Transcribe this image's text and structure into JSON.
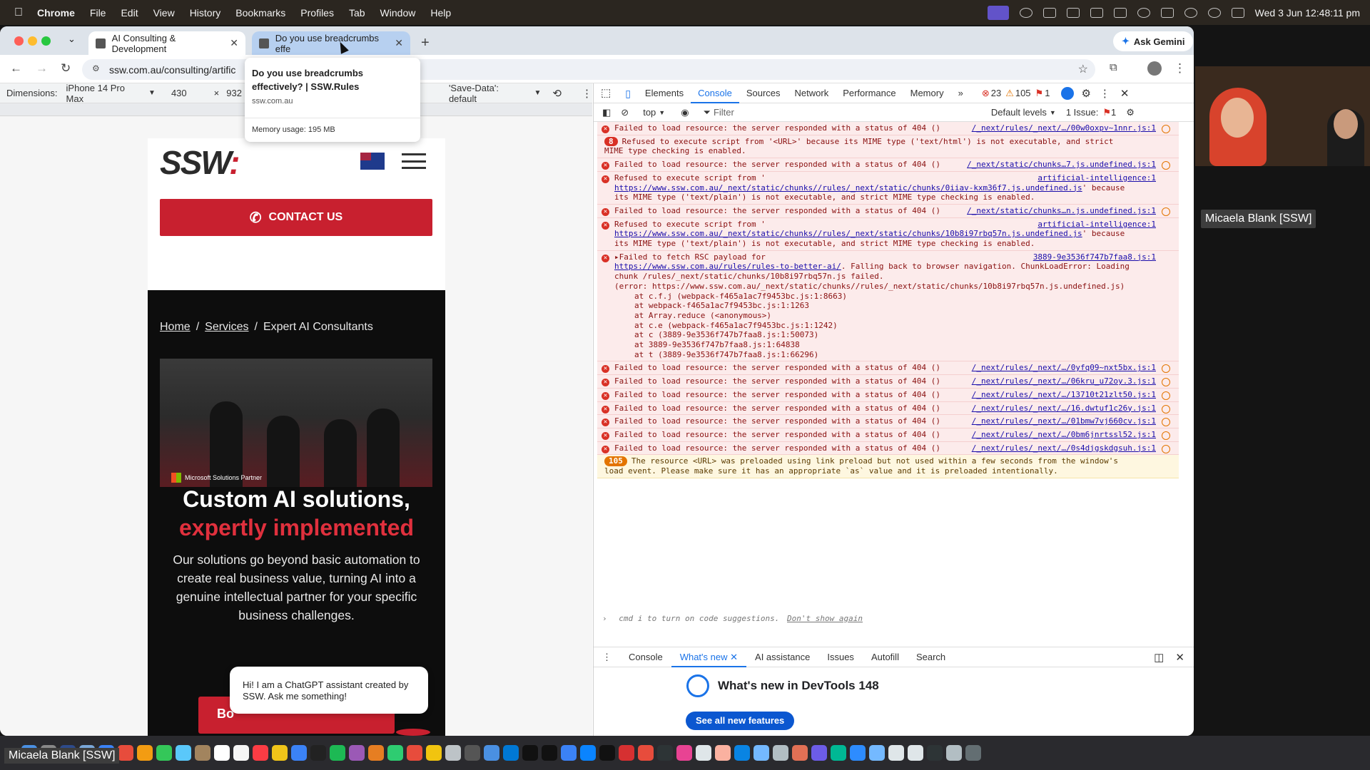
{
  "menubar": {
    "app": "Chrome",
    "items": [
      "File",
      "Edit",
      "View",
      "History",
      "Bookmarks",
      "Profiles",
      "Tab",
      "Window",
      "Help"
    ],
    "clock": "Wed 3 Jun  12:48:11 pm"
  },
  "browser": {
    "tabs": [
      {
        "label": "AI Consulting & Development"
      },
      {
        "label": "Do you use breadcrumbs effe"
      }
    ],
    "ask_gemini": "Ask Gemini",
    "url": "ssw.com.au/consulting/artific",
    "hovercard": {
      "title": "Do you use breadcrumbs effectively? | SSW.Rules",
      "domain": "ssw.com.au",
      "memory": "Memory usage: 195 MB"
    }
  },
  "device": {
    "label": "Dimensions:",
    "model": "iPhone 14 Pro Max",
    "width": "430",
    "times": "×",
    "height": "932",
    "savedata": "'Save-Data': default"
  },
  "page": {
    "logo": "SSW",
    "contact": "CONTACT US",
    "breadcrumb": {
      "home": "Home",
      "services": "Services",
      "current": "Expert AI Consultants"
    },
    "badge": "Microsoft Solutions Partner",
    "heading_line1": "Custom AI solutions,",
    "heading_line2": "expertly implemented",
    "lead": "Our solutions go beyond basic automation to create real business value, turning AI into a genuine intellectual partner for your specific business challenges.",
    "book_label": "Bo",
    "chat": "Hi! I am a ChatGPT assistant created by SSW. Ask me something!"
  },
  "devtools": {
    "tabs": [
      "Elements",
      "Console",
      "Sources",
      "Network",
      "Performance",
      "Memory"
    ],
    "errors": "23",
    "warnings": "105",
    "issues_flag": "1",
    "context": "top",
    "filter": "Filter",
    "levels": "Default levels",
    "issues": "1 Issue:",
    "issues_count": "1",
    "messages": [
      {
        "kind": "error",
        "text": "Failed to load resource: the server responded with a status of 404 ()",
        "src": "/_next/rules/_next/…/00w0oxpv~1nnr.js:1"
      },
      {
        "kind": "group",
        "badge": "8",
        "text": "Refused to execute script from '<URL>' because its MIME type ('text/html') is not executable, and strict MIME type checking is enabled."
      },
      {
        "kind": "error",
        "text": "Failed to load resource: the server responded with a status of 404 ()",
        "src": "/_next/static/chunks…7.js.undefined.js:1"
      },
      {
        "kind": "error",
        "text": "Refused to execute script from '",
        "link": "https://www.ssw.com.au/_next/static/chunks//rules/_next/static/chunks/0iiav-kxm36f7.js.undefined.js",
        "after": "' because its MIME type ('text/plain') is not executable, and strict MIME type checking is enabled.",
        "src": "artificial-intelligence:1"
      },
      {
        "kind": "error",
        "text": "Failed to load resource: the server responded with a status of 404 ()",
        "src": "/_next/static/chunks…n.js.undefined.js:1"
      },
      {
        "kind": "error",
        "text": "Refused to execute script from '",
        "link": "https://www.ssw.com.au/_next/static/chunks//rules/_next/static/chunks/10b8i97rbq57n.js.undefined.js",
        "after": "' because its MIME type ('text/plain') is not executable, and strict MIME type checking is enabled.",
        "src": "artificial-intelligence:1"
      },
      {
        "kind": "error",
        "text": "▸Failed to fetch RSC payload for",
        "link": "https://www.ssw.com.au/rules/rules-to-better-ai/",
        "after": ". Falling back to browser navigation. ChunkLoadError: Loading chunk /rules/_next/static/chunks/10b8i97rbq57n.js failed.",
        "src": "3889-9e3536f747b7faa8.js:1",
        "trace": [
          "(error: https://www.ssw.com.au/_next/static/chunks//rules/_next/static/chunks/10b8i97rbq57n.js.undefined.js)",
          "at c.f.j (webpack-f465a1ac7f9453bc.js:1:8663)",
          "at webpack-f465a1ac7f9453bc.js:1:1263",
          "at Array.reduce (<anonymous>)",
          "at c.e (webpack-f465a1ac7f9453bc.js:1:1242)",
          "at c (3889-9e3536f747b7faa8.js:1:50073)",
          "at 3889-9e3536f747b7faa8.js:1:64838",
          "at t (3889-9e3536f747b7faa8.js:1:66296)"
        ]
      },
      {
        "kind": "error",
        "text": "Failed to load resource: the server responded with a status of 404 ()",
        "src": "/_next/rules/_next/…/0yfq09~nxt5bx.js:1"
      },
      {
        "kind": "error",
        "text": "Failed to load resource: the server responded with a status of 404 ()",
        "src": "/_next/rules/_next/…/06kru_u72oy.3.js:1"
      },
      {
        "kind": "error",
        "text": "Failed to load resource: the server responded with a status of 404 ()",
        "src": "/_next/rules/_next/…/13710t21zlt50.js:1"
      },
      {
        "kind": "error",
        "text": "Failed to load resource: the server responded with a status of 404 ()",
        "src": "/_next/rules/_next/…/16.dwtuf1c26y.js:1"
      },
      {
        "kind": "error",
        "text": "Failed to load resource: the server responded with a status of 404 ()",
        "src": "/_next/rules/_next/…/01bmw7vj660cv.js:1"
      },
      {
        "kind": "error",
        "text": "Failed to load resource: the server responded with a status of 404 ()",
        "src": "/_next/rules/_next/…/0bm6jnrtssl52.js:1"
      },
      {
        "kind": "error",
        "text": "Failed to load resource: the server responded with a status of 404 ()",
        "src": "/_next/rules/_next/…/0s4djgskdgsuh.js:1"
      },
      {
        "kind": "warn",
        "badge": "105",
        "text": "The resource <URL> was preloaded using link preload but not used within a few seconds from the window's load event. Please make sure it has an appropriate `as` value and it is preloaded intentionally."
      }
    ],
    "prompt": "cmd  i  to turn on code suggestions.",
    "prompt_link": "Don't show again",
    "drawer_tabs": [
      "Console",
      "What's new",
      "AI assistance",
      "Issues",
      "Autofill",
      "Search"
    ],
    "whats_new": "What's new in DevTools 148",
    "see_all": "See all new features"
  },
  "zoom": {
    "speaker": "Micaela Blank [SSW]",
    "self": "Micaela Blank [SSW]"
  }
}
